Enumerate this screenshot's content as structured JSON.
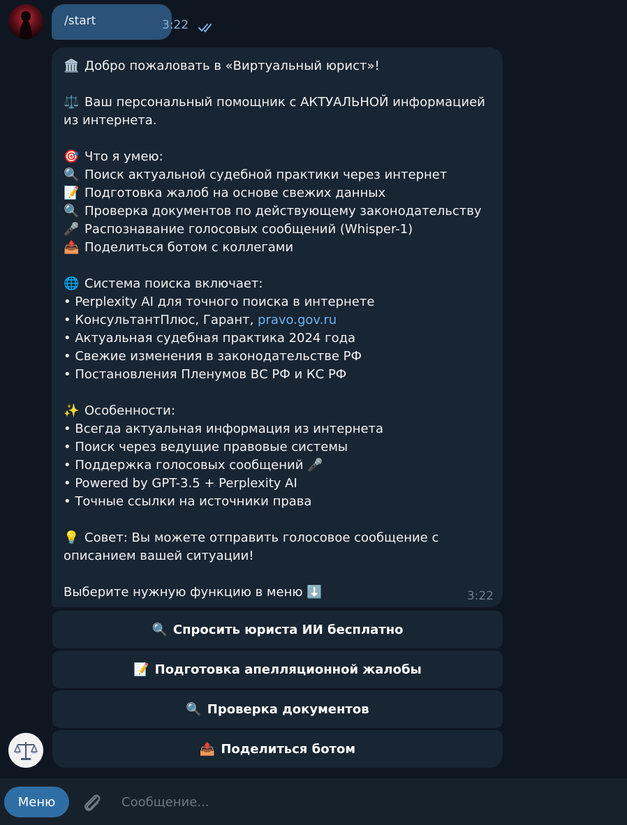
{
  "outgoing": {
    "text": "/start",
    "time": "3:22"
  },
  "bot_message": {
    "lines": [
      {
        "emoji": "🏛️",
        "text": "Добро пожаловать в «Виртуальный юрист»!"
      },
      {
        "emoji": "⚖️",
        "text": "Ваш персональный помощник с АКТУАЛЬНОЙ информацией"
      },
      {
        "emoji": "",
        "text": "из интернета."
      },
      {
        "emoji": "🎯",
        "text": "Что я умею:"
      },
      {
        "emoji": "🔍",
        "text": "Поиск актуальной судебной практики через интернет"
      },
      {
        "emoji": "📝",
        "text": "Подготовка жалоб на основе свежих данных"
      },
      {
        "emoji": "🔍",
        "text": "Проверка документов по действующему законодательству"
      },
      {
        "emoji": "🎤",
        "text": "Распознавание голосовых сообщений (Whisper-1)"
      },
      {
        "emoji": "📤",
        "text": "Поделиться ботом с коллегами"
      },
      {
        "emoji": "🌐",
        "text": "Система поиска включает:"
      },
      {
        "emoji": "",
        "text": "• Perplexity AI для точного поиска в интернете"
      },
      {
        "emoji": "",
        "text": "• КонсультантПлюс, Гарант, ",
        "link": "pravo.gov.ru"
      },
      {
        "emoji": "",
        "text": "• Актуальная судебная практика 2024 года"
      },
      {
        "emoji": "",
        "text": "• Свежие изменения в законодательстве РФ"
      },
      {
        "emoji": "",
        "text": "• Постановления Пленумов ВС РФ и КС РФ"
      },
      {
        "emoji": "✨",
        "text": "Особенности:"
      },
      {
        "emoji": "",
        "text": "• Всегда актуальная информация из интернета"
      },
      {
        "emoji": "",
        "text": "• Поиск через ведущие правовые системы"
      },
      {
        "emoji": "",
        "text": "• Поддержка голосовых сообщений 🎤"
      },
      {
        "emoji": "",
        "text": "• Powered by GPT-3.5 + Perplexity AI"
      },
      {
        "emoji": "",
        "text": "• Точные ссылки на источники права"
      },
      {
        "emoji": "💡",
        "text": "Совет: Вы можете отправить голосовое сообщение с"
      },
      {
        "emoji": "",
        "text": "описанием вашей ситуации!"
      },
      {
        "emoji": "",
        "text": "Выберите нужную функцию в меню ⬇️"
      }
    ],
    "time": "3:22"
  },
  "keyboard": [
    {
      "emoji": "🔍",
      "label": "Спросить юриста ИИ бесплатно"
    },
    {
      "emoji": "📝",
      "label": "Подготовка апелляционной жалобы"
    },
    {
      "emoji": "🔍",
      "label": "Проверка документов"
    },
    {
      "emoji": "📤",
      "label": "Поделиться ботом"
    }
  ],
  "composer": {
    "menu_label": "Меню",
    "placeholder": "Сообщение..."
  },
  "colors": {
    "background": "#0e1621",
    "incoming_bubble": "#182533",
    "outgoing_bubble": "#2b5278",
    "link": "#6ab3f3",
    "menu_button": "#2f6ea5"
  },
  "icons": {
    "read_status": "double-check-icon",
    "attach": "paperclip-icon",
    "bot_avatar": "scales-of-justice-icon"
  }
}
